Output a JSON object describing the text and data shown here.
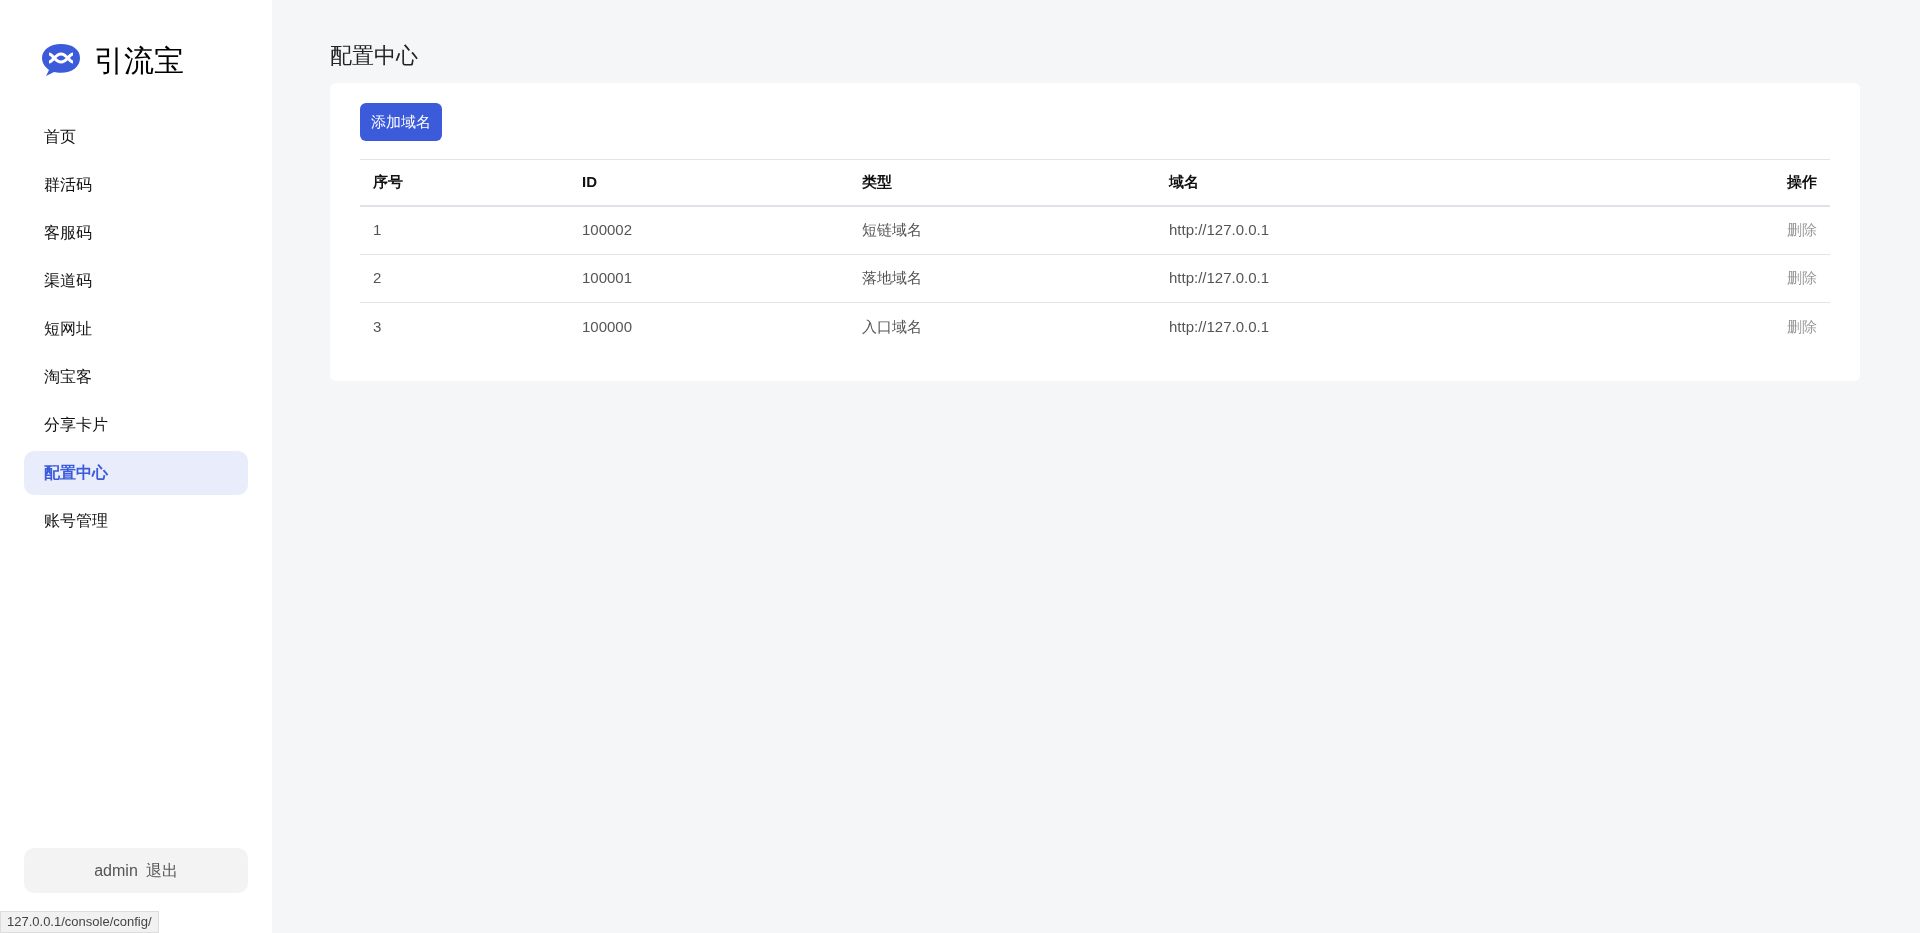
{
  "brand": {
    "name": "引流宝"
  },
  "nav": [
    {
      "label": "首页",
      "selected": false
    },
    {
      "label": "群活码",
      "selected": false
    },
    {
      "label": "客服码",
      "selected": false
    },
    {
      "label": "渠道码",
      "selected": false
    },
    {
      "label": "短网址",
      "selected": false
    },
    {
      "label": "淘宝客",
      "selected": false
    },
    {
      "label": "分享卡片",
      "selected": false
    },
    {
      "label": "配置中心",
      "selected": true
    },
    {
      "label": "账号管理",
      "selected": false
    }
  ],
  "user": {
    "name": "admin",
    "logout": "退出"
  },
  "status_url": "127.0.0.1/console/config/",
  "page_title": "配置中心",
  "add_button": "添加域名",
  "table": {
    "columns": [
      "序号",
      "ID",
      "类型",
      "域名",
      "操作"
    ],
    "rows": [
      {
        "cells": [
          "1",
          "100002",
          "短链域名",
          "http://127.0.0.1"
        ],
        "action": "删除"
      },
      {
        "cells": [
          "2",
          "100001",
          "落地域名",
          "http://127.0.0.1"
        ],
        "action": "删除"
      },
      {
        "cells": [
          "3",
          "100000",
          "入口域名",
          "http://127.0.0.1"
        ],
        "action": "删除"
      }
    ]
  }
}
